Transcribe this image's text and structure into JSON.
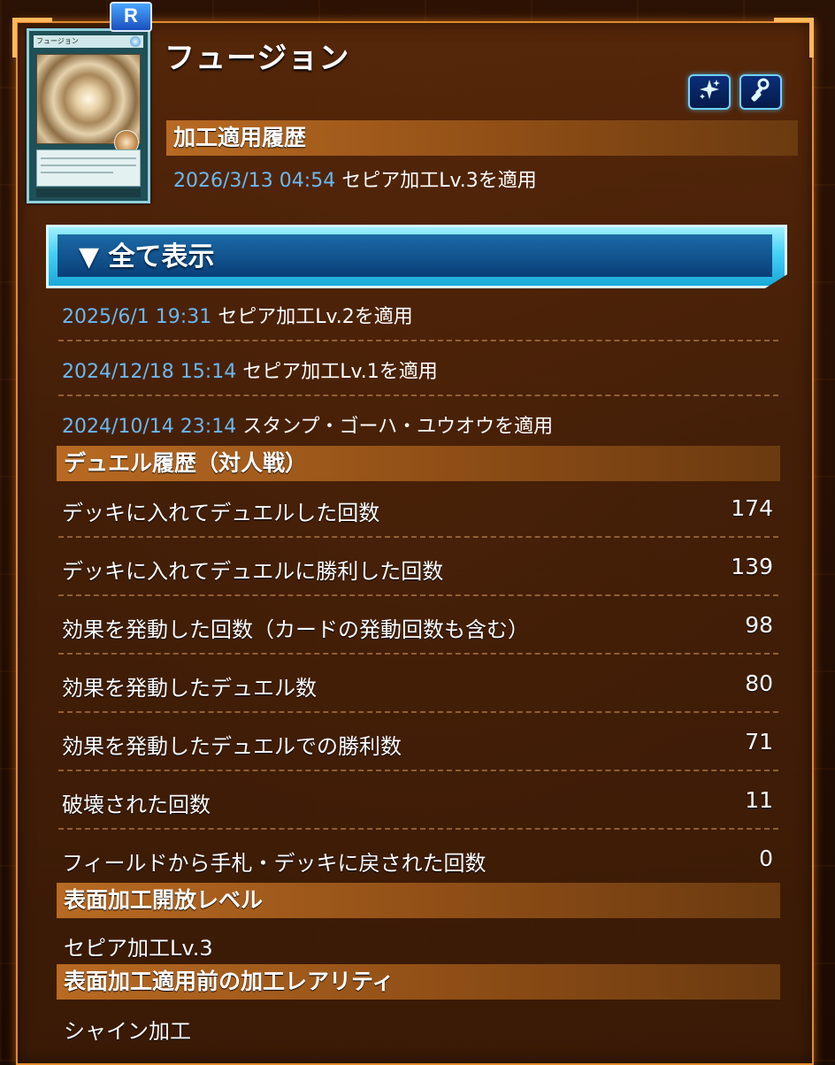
{
  "card": {
    "name": "フュージョン",
    "rarity": "R",
    "thumb_name": "フュージョン"
  },
  "icons": {
    "sparkle_button": "sparkle-icon",
    "stamp_button": "stamp-icon"
  },
  "processing_history": {
    "header": "加工適用履歴",
    "latest": {
      "timestamp": "2026/3/13 04:54",
      "text": "セピア加工Lv.3を適用"
    },
    "expand_label": "▼ 全て表示",
    "items": [
      {
        "timestamp": "2025/6/1 19:31",
        "text": "セピア加工Lv.2を適用"
      },
      {
        "timestamp": "2024/12/18 15:14",
        "text": "セピア加工Lv.1を適用"
      },
      {
        "timestamp": "2024/10/14 23:14",
        "text": "スタンプ・ゴーハ・ユウオウを適用"
      }
    ]
  },
  "duel_history": {
    "header": "デュエル履歴（対人戦）",
    "stats": [
      {
        "label": "デッキに入れてデュエルした回数",
        "value": "174"
      },
      {
        "label": "デッキに入れてデュエルに勝利した回数",
        "value": "139"
      },
      {
        "label": "効果を発動した回数（カードの発動回数も含む）",
        "value": "98"
      },
      {
        "label": "効果を発動したデュエル数",
        "value": "80"
      },
      {
        "label": "効果を発動したデュエルでの勝利数",
        "value": "71"
      },
      {
        "label": "破壊された回数",
        "value": "11"
      },
      {
        "label": "フィールドから手札・デッキに戻された回数",
        "value": "0"
      }
    ]
  },
  "surface_level": {
    "header": "表面加工開放レベル",
    "value": "セピア加工Lv.3"
  },
  "original_rarity": {
    "header": "表面加工適用前の加工レアリティ",
    "value": "シャイン加工"
  },
  "colors": {
    "accent_orange": "#e08a2c",
    "timestamp_blue": "#6bb8f0",
    "button_cyan": "#45d0f5"
  }
}
